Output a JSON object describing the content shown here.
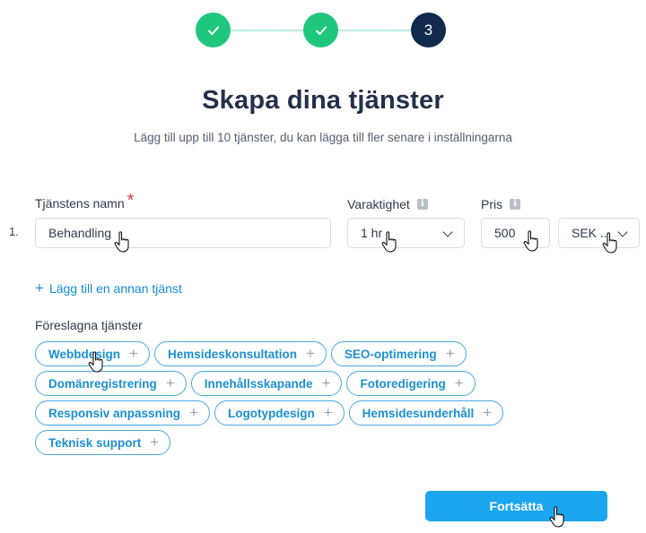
{
  "stepper": {
    "steps": [
      {
        "state": "done",
        "label": "✓"
      },
      {
        "state": "done",
        "label": "✓"
      },
      {
        "state": "current",
        "label": "3"
      }
    ]
  },
  "header": {
    "title": "Skapa dina tjänster",
    "subtitle": "Lägg till upp till 10 tjänster, du kan lägga till fler senare i inställningarna"
  },
  "form": {
    "name_label": "Tjänstens namn",
    "required_mark": "*",
    "duration_label": "Varaktighet",
    "price_label": "Pris",
    "info_icon": "i",
    "rows": [
      {
        "number": "1.",
        "name": "Behandling",
        "duration": "1 hr",
        "price": "500",
        "currency": "SEK ..."
      }
    ]
  },
  "add_service_link": {
    "icon": "+",
    "label": "Lägg till en annan tjänst"
  },
  "suggestions": {
    "label": "Föreslagna tjänster",
    "chip_plus": "+",
    "items": [
      "Webbdesign",
      "Hemsideskonsultation",
      "SEO-optimering",
      "Domänregistrering",
      "Innehållsskapande",
      "Fotoredigering",
      "Responsiv anpassning",
      "Logotypdesign",
      "Hemsidesunderhåll",
      "Teknisk support"
    ]
  },
  "continue_button": {
    "label": "Fortsätta"
  },
  "colors": {
    "accent": "#1ba5ef",
    "step_done": "#1ec77d",
    "step_current": "#10294d",
    "required": "#e53950"
  }
}
